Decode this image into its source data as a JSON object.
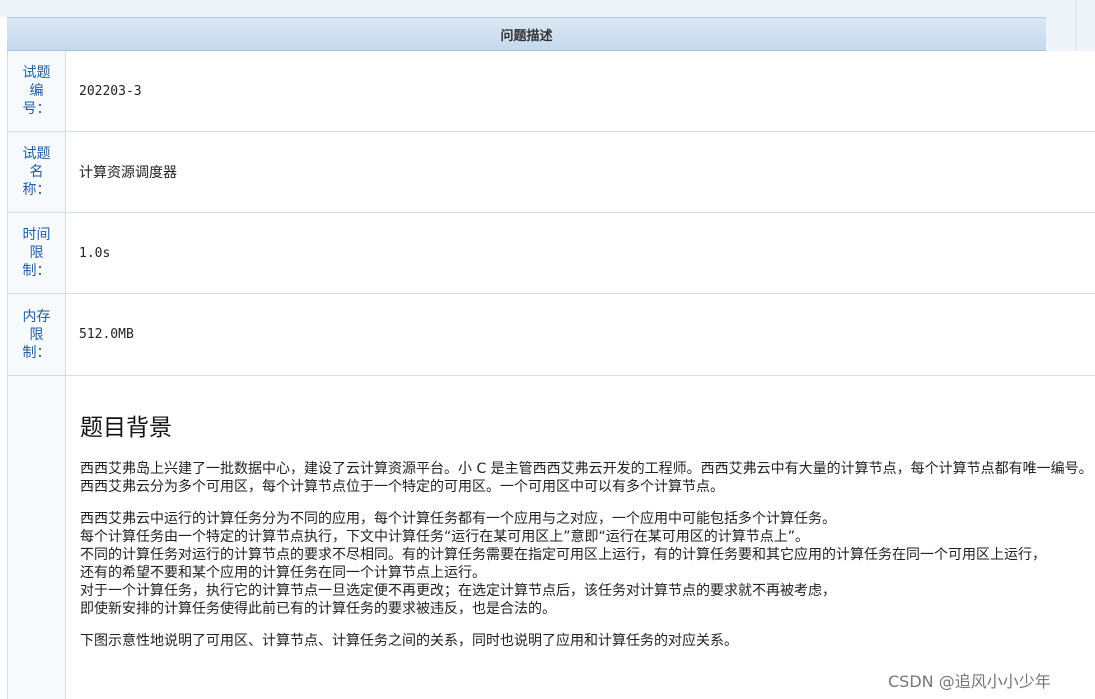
{
  "header": {
    "title": "问题描述"
  },
  "rows": [
    {
      "label": "试题编号：",
      "value": "202203-3"
    },
    {
      "label": "试题名称：",
      "value": "计算资源调度器"
    },
    {
      "label": "时间限制：",
      "value": "1.0s"
    },
    {
      "label": "内存限制：",
      "value": "512.0MB"
    }
  ],
  "content": {
    "heading": "题目背景",
    "para1": "西西艾弗岛上兴建了一批数据中心，建设了云计算资源平台。小 C 是主管西西艾弗云开发的工程师。西西艾弗云中有大量的计算节点，每个计算节点都有唯一编号。",
    "para2": "西西艾弗云分为多个可用区，每个计算节点位于一个特定的可用区。一个可用区中可以有多个计算节点。",
    "para3": "西西艾弗云中运行的计算任务分为不同的应用，每个计算任务都有一个应用与之对应，一个应用中可能包括多个计算任务。",
    "para4": "每个计算任务由一个特定的计算节点执行，下文中计算任务“运行在某可用区上”意即“运行在某可用区的计算节点上”。",
    "para5": "不同的计算任务对运行的计算节点的要求不尽相同。有的计算任务需要在指定可用区上运行，有的计算任务要和其它应用的计算任务在同一个可用区上运行，",
    "para6": "还有的希望不要和某个应用的计算任务在同一个计算节点上运行。",
    "para7": "对于一个计算任务，执行它的计算节点一旦选定便不再更改；在选定计算节点后，该任务对计算节点的要求就不再被考虑，",
    "para8": "即使新安排的计算任务使得此前已有的计算任务的要求被违反，也是合法的。",
    "para9": "下图示意性地说明了可用区、计算节点、计算任务之间的关系，同时也说明了应用和计算任务的对应关系。"
  },
  "watermark": "CSDN @追风小小少年"
}
